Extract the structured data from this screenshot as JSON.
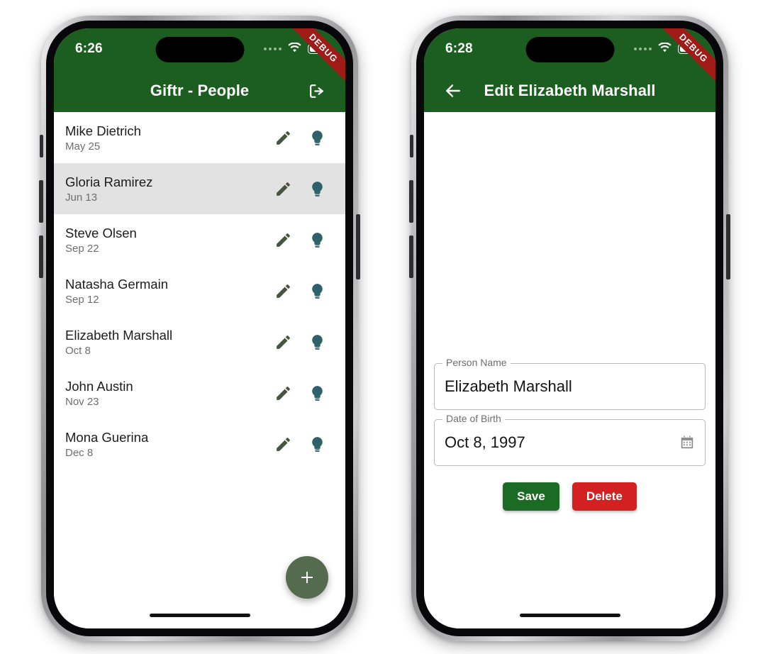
{
  "phones": [
    {
      "id": "people-list-phone",
      "status": {
        "time": "6:26",
        "wifi_icon": "wifi-icon",
        "battery_icon": "battery-icon",
        "signal_icon": "signal-dots-icon"
      },
      "ribbon": "DEBUG",
      "appbar": {
        "title": "Giftr - People",
        "trailing_icon": "logout-icon",
        "leading_icon": null,
        "background": "#1b5e20"
      },
      "list": {
        "edit_icon": "pencil-icon",
        "idea_icon": "lightbulb-icon",
        "items": [
          {
            "name": "Mike Dietrich",
            "date": "May 25",
            "selected": false
          },
          {
            "name": "Gloria Ramirez",
            "date": "Jun 13",
            "selected": true
          },
          {
            "name": "Steve Olsen",
            "date": "Sep 22",
            "selected": false
          },
          {
            "name": "Natasha Germain",
            "date": "Sep 12",
            "selected": false
          },
          {
            "name": "Elizabeth Marshall",
            "date": "Oct 8",
            "selected": false
          },
          {
            "name": "John Austin",
            "date": "Nov 23",
            "selected": false
          },
          {
            "name": "Mona Guerina",
            "date": "Dec 8",
            "selected": false
          }
        ]
      },
      "fab": {
        "icon": "plus-icon",
        "color": "#556b4f"
      }
    },
    {
      "id": "edit-person-phone",
      "status": {
        "time": "6:28",
        "wifi_icon": "wifi-icon",
        "battery_icon": "battery-icon",
        "signal_icon": "signal-dots-icon"
      },
      "ribbon": "DEBUG",
      "appbar": {
        "title": "Edit Elizabeth Marshall",
        "leading_icon": "back-arrow-icon",
        "trailing_icon": null,
        "background": "#1b5e20"
      },
      "form": {
        "fields": [
          {
            "label": "Person Name",
            "value": "Elizabeth Marshall",
            "trailing_icon": null
          },
          {
            "label": "Date of Birth",
            "value": "Oct 8, 1997",
            "trailing_icon": "calendar-icon"
          }
        ],
        "actions": [
          {
            "label": "Save",
            "color": "#1b6b24"
          },
          {
            "label": "Delete",
            "color": "#d32020"
          }
        ]
      }
    }
  ],
  "colors": {
    "app_bar_green": "#1b5e20",
    "ribbon_red": "#a01b18",
    "lightbulb_teal": "#2f6268",
    "pencil_olive": "#48533f",
    "selected_row": "#e2e2e2"
  }
}
